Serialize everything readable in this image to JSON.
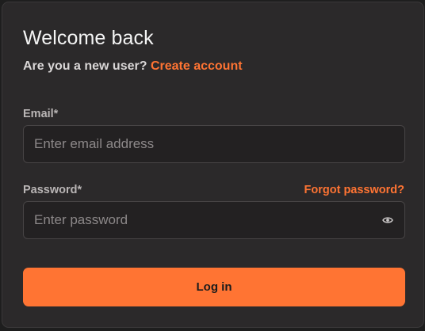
{
  "form": {
    "title": "Welcome back",
    "new_user_prompt": "Are you a new user?",
    "create_account_link": "Create account",
    "email_label": "Email*",
    "email_placeholder": "Enter email address",
    "email_value": "",
    "password_label": "Password*",
    "forgot_password_link": "Forgot password?",
    "password_placeholder": "Enter password",
    "password_value": "",
    "login_button": "Log in"
  },
  "icons": {
    "password_toggle": "eye-icon"
  },
  "colors": {
    "background": "#1e1e1e",
    "card": "#2b292a",
    "accent": "#ff7433",
    "input_bg": "#232122",
    "input_border": "#474445"
  }
}
